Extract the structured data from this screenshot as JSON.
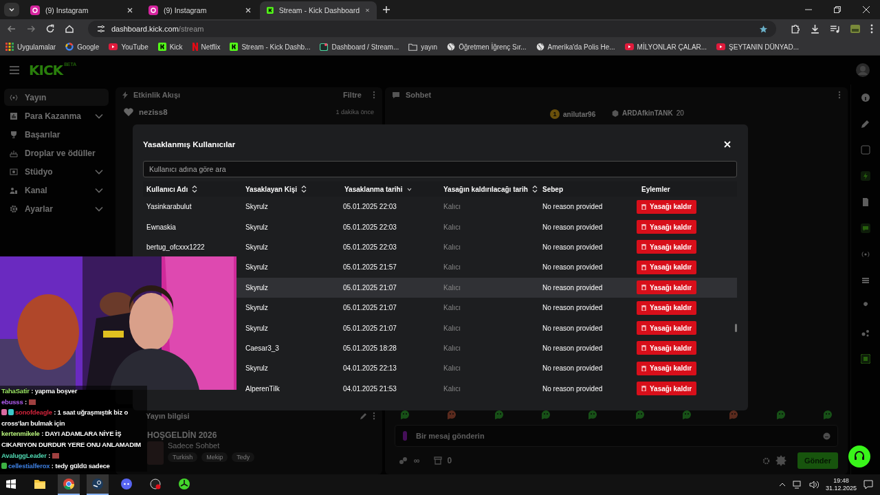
{
  "browser": {
    "tabs": [
      {
        "title": "(9) Instagram",
        "kind": "instagram",
        "selected": false
      },
      {
        "title": "(9) Instagram",
        "kind": "instagram",
        "selected": false
      },
      {
        "title": "Stream - Kick Dashboard",
        "kind": "kick",
        "selected": true
      }
    ],
    "url": {
      "host": "dashboard.kick.com",
      "path": "/stream"
    },
    "bookmarks": [
      {
        "label": "Uygulamalar",
        "kind": "apps"
      },
      {
        "label": "Google",
        "kind": "google"
      },
      {
        "label": "YouTube",
        "kind": "youtube"
      },
      {
        "label": "Kick",
        "kind": "kick"
      },
      {
        "label": "Netflix",
        "kind": "netflix"
      },
      {
        "label": "Stream - Kick Dashb...",
        "kind": "kick"
      },
      {
        "label": "Dashboard / Stream...",
        "kind": "dashboard"
      },
      {
        "label": "yayın",
        "kind": "folder"
      },
      {
        "label": "Öğretmen İğrenç Sır...",
        "kind": "globe"
      },
      {
        "label": "Amerika'da Polis He...",
        "kind": "globe"
      },
      {
        "label": "MİLYONLAR ÇALAR...",
        "kind": "youtube"
      },
      {
        "label": "ŞEYTANIN DÜNYAD...",
        "kind": "youtube"
      }
    ]
  },
  "header": {
    "logo": "KICK",
    "logo_badge": "BETA"
  },
  "sidebar": {
    "items": [
      {
        "label": "Yayın",
        "selected": true,
        "has_submenu": false
      },
      {
        "label": "Para Kazanma",
        "selected": false,
        "has_submenu": true
      },
      {
        "label": "Başarılar",
        "selected": false,
        "has_submenu": false
      },
      {
        "label": "Droplar ve ödüller",
        "selected": false,
        "has_submenu": false
      },
      {
        "label": "Stüdyo",
        "selected": false,
        "has_submenu": true
      },
      {
        "label": "Kanal",
        "selected": false,
        "has_submenu": true
      },
      {
        "label": "Ayarlar",
        "selected": false,
        "has_submenu": true
      }
    ]
  },
  "activity_feed": {
    "title": "Etkinlik Akışı",
    "filter": "Filtre",
    "events": [
      {
        "user": "neziss8",
        "time": "1 dakika önce"
      }
    ]
  },
  "stream_info": {
    "title": "Yayın bilgisi",
    "stream_title": "HOŞGELDİN 2026",
    "category": "Sadece Sohbet",
    "tags": [
      "Turkish",
      "Mekip",
      "Tedy"
    ]
  },
  "chat": {
    "title": "Sohbet",
    "top_users": [
      {
        "name": "anilutar96",
        "rank": "1"
      },
      {
        "name": "ARDAfkinTANK",
        "count": "20"
      }
    ],
    "input": {
      "placeholder": "Bir mesaj gönderin"
    },
    "points": "∞",
    "store_count": "0",
    "send": "Gönder"
  },
  "modal": {
    "title": "Yasaklanmış Kullanıcılar",
    "search": {
      "placeholder": "Kullanıcı adına göre ara"
    },
    "columns": [
      {
        "label": "Kullanıcı Adı",
        "sortable": true,
        "sorted_desc": false
      },
      {
        "label": "Yasaklayan Kişi",
        "sortable": true,
        "sorted_desc": false
      },
      {
        "label": "Yasaklanma tarihi",
        "sortable": true,
        "sorted_desc": true
      },
      {
        "label": "Yasağın kaldırılacağı tarih",
        "sortable": true,
        "sorted_desc": false
      },
      {
        "label": "Sebep",
        "sortable": false,
        "sorted_desc": false
      },
      {
        "label": "Eylemler",
        "sortable": false,
        "sorted_desc": false
      }
    ],
    "rows": [
      {
        "user": "Yasinkarabulut",
        "banned_by": "Skyrulz",
        "date": "05.01.2025 22:03",
        "until": "Kalıcı",
        "reason": "No reason provided",
        "action": "Yasağı kaldır",
        "selected": false
      },
      {
        "user": "Ewnaskia",
        "banned_by": "Skyrulz",
        "date": "05.01.2025 22:03",
        "until": "Kalıcı",
        "reason": "No reason provided",
        "action": "Yasağı kaldır",
        "selected": false
      },
      {
        "user": "bertug_ofcxxx1222",
        "banned_by": "Skyrulz",
        "date": "05.01.2025 22:03",
        "until": "Kalıcı",
        "reason": "No reason provided",
        "action": "Yasağı kaldır",
        "selected": false
      },
      {
        "banned_by": "Skyrulz",
        "date": "05.01.2025 21:57",
        "until": "Kalıcı",
        "reason": "No reason provided",
        "action": "Yasağı kaldır",
        "selected": false
      },
      {
        "banned_by": "Skyrulz",
        "date": "05.01.2025 21:07",
        "until": "Kalıcı",
        "reason": "No reason provided",
        "action": "Yasağı kaldır",
        "selected": true
      },
      {
        "banned_by": "Skyrulz",
        "date": "05.01.2025 21:07",
        "until": "Kalıcı",
        "reason": "No reason provided",
        "action": "Yasağı kaldır",
        "selected": false
      },
      {
        "banned_by": "Skyrulz",
        "date": "05.01.2025 21:07",
        "until": "Kalıcı",
        "reason": "No reason provided",
        "action": "Yasağı kaldır",
        "selected": false
      },
      {
        "banned_by": "Caesar3_3",
        "date": "05.01.2025 18:28",
        "until": "Kalıcı",
        "reason": "No reason provided",
        "action": "Yasağı kaldır",
        "selected": false
      },
      {
        "banned_by": "Skyrulz",
        "date": "04.01.2025 22:13",
        "until": "Kalıcı",
        "reason": "No reason provided",
        "action": "Yasağı kaldır",
        "selected": false
      },
      {
        "banned_by": "AlperenTilk",
        "date": "04.01.2025 21:53",
        "until": "Kalıcı",
        "reason": "No reason provided",
        "action": "Yasağı kaldır",
        "selected": false
      }
    ]
  },
  "stream_chat": [
    {
      "user": "TahaSatir",
      "color": "#9be564",
      "text": ": yapma boşver",
      "emote": false
    },
    {
      "user": "ebusss",
      "color": "#b05cf0",
      "text": ":",
      "emote": true
    },
    {
      "user": "sonofdeagle",
      "color": "#d0233a",
      "text": ": 1 saat uğraşmıştık biz o cross'ları bulmak için",
      "emote": false,
      "badges": [
        {
          "color": "#d86aa0"
        },
        {
          "color": "#3cc8c8"
        }
      ]
    },
    {
      "user": "kertenmikele",
      "color": "#b6f07a",
      "text": ": DAYI ADAMLARA NİYE İŞ CIKARIYON DURDUR YERE ONU ANLAMADIM",
      "emote": false
    },
    {
      "user": "AvaluggLeader",
      "color": "#4fd6b0",
      "text": ":",
      "emote": true
    },
    {
      "user": "cellestialferox",
      "color": "#3d7fe0",
      "text": ": tedy güldü sadece",
      "emote": false,
      "badges": [
        {
          "color": "#3cb043"
        }
      ]
    }
  ],
  "taskbar": {
    "apps": [
      {
        "kind": "start"
      },
      {
        "kind": "folder"
      },
      {
        "kind": "browser",
        "selected": true
      },
      {
        "kind": "steam",
        "selected": true
      },
      {
        "kind": "discord",
        "selected": false
      },
      {
        "kind": "obs",
        "selected": false
      },
      {
        "kind": "razer",
        "selected": false
      }
    ],
    "time": "19:48",
    "date": "31.12.2025"
  }
}
